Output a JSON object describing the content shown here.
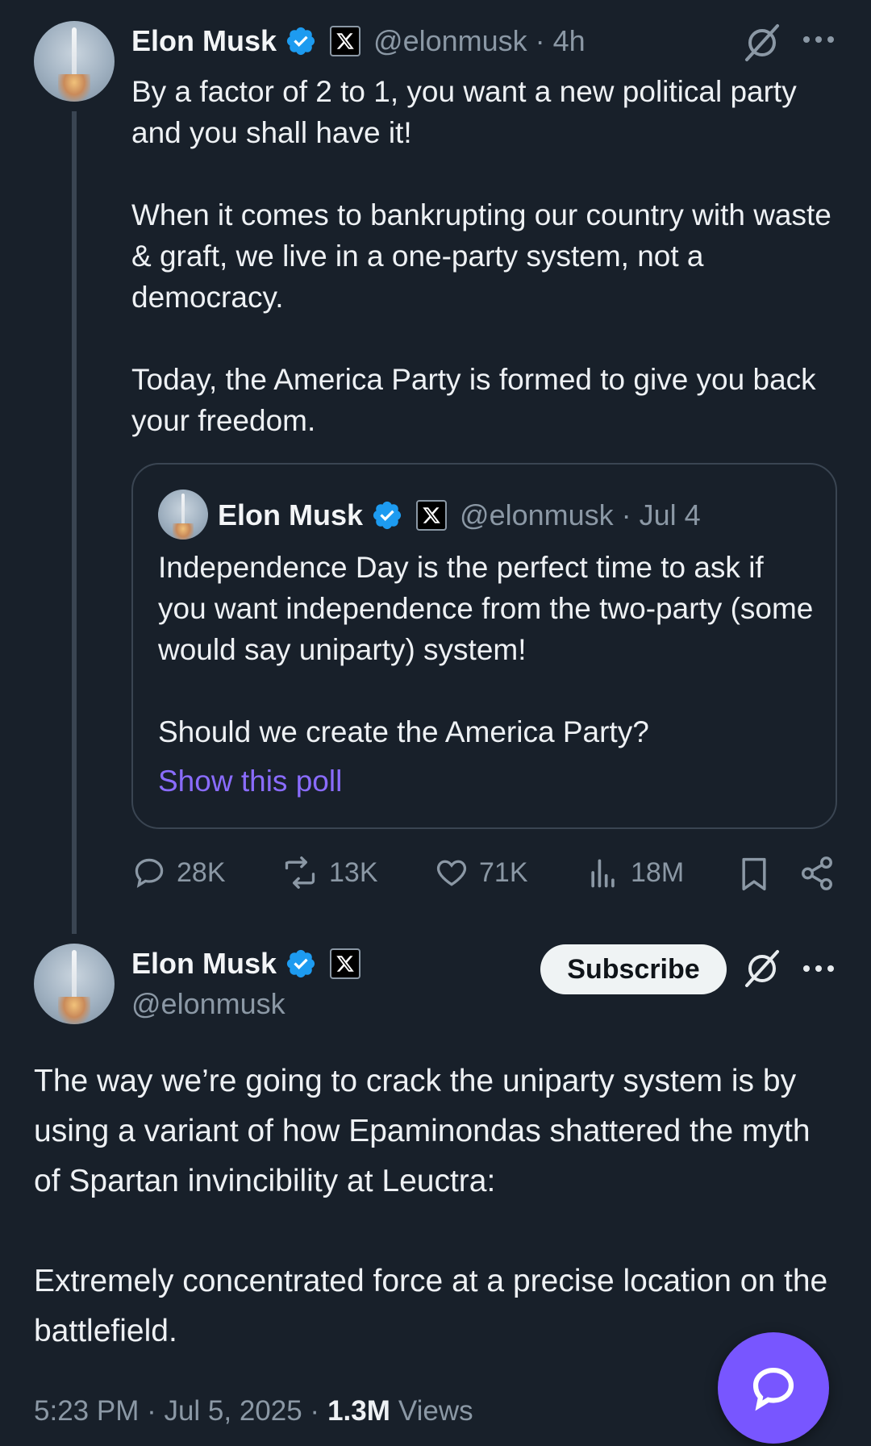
{
  "tweet1": {
    "name": "Elon Musk",
    "handle": "@elonmusk",
    "time": "· 4h",
    "text": "By a factor of 2 to 1, you want a new political party and you shall have it!\n\nWhen it comes to bankrupting our country with waste & graft, we live in a one-party system, not a democracy.\n\nToday, the America Party is formed to give you back your freedom.",
    "quote": {
      "name": "Elon Musk",
      "handle": "@elonmusk",
      "time": "· Jul 4",
      "text": "Independence Day is the perfect time to ask if you want independence from the two-party (some would say uniparty) system!\n\nShould we create the America Party?",
      "poll_link": "Show this poll"
    },
    "actions": {
      "replies": "28K",
      "reposts": "13K",
      "likes": "71K",
      "views": "18M"
    }
  },
  "tweet2": {
    "name": "Elon Musk",
    "handle": "@elonmusk",
    "subscribe_label": "Subscribe",
    "text": "The way we’re going to crack the uniparty system is by using a variant of how Epaminondas shattered the myth of Spartan invincibility at Leuctra:\n\nExtremely concentrated force at a precise location on the battlefield.",
    "timestamp": "5:23 PM · Jul 5, 2025 ·",
    "views_count": "1.3M",
    "views_label": "Views"
  },
  "colors": {
    "background": "#18202a",
    "verified": "#1d9bf0",
    "accent": "#7856ff",
    "link": "#8a6cff",
    "muted": "#8b98a5"
  },
  "icons": [
    "verified-badge-icon",
    "x-logo-icon",
    "grok-icon",
    "more-icon",
    "reply-icon",
    "repost-icon",
    "like-icon",
    "views-icon",
    "bookmark-icon",
    "share-icon",
    "compose-reply-icon"
  ]
}
